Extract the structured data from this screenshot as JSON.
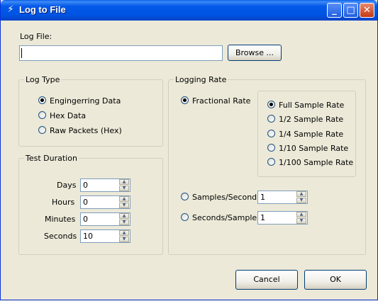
{
  "window": {
    "title": "Log to File",
    "min": "_",
    "max": "□",
    "close": "✕"
  },
  "log_file": {
    "label": "Log File:",
    "value": "",
    "browse_label": "Browse ..."
  },
  "log_type": {
    "title": "Log Type",
    "options": [
      {
        "label": "Engingerring Data",
        "checked": true
      },
      {
        "label": "Hex Data",
        "checked": false
      },
      {
        "label": "Raw Packets (Hex)",
        "checked": false
      }
    ]
  },
  "test_duration": {
    "title": "Test Duration",
    "fields": [
      {
        "label": "Days",
        "value": "0"
      },
      {
        "label": "Hours",
        "value": "0"
      },
      {
        "label": "Minutes",
        "value": "0"
      },
      {
        "label": "Seconds",
        "value": "10"
      }
    ]
  },
  "logging_rate": {
    "title": "Logging Rate",
    "fractional_label": "Fractional Rate",
    "fractional_checked": true,
    "sub_options": [
      {
        "label": "Full Sample Rate",
        "checked": true
      },
      {
        "label": "1/2 Sample Rate",
        "checked": false
      },
      {
        "label": "1/4 Sample Rate",
        "checked": false
      },
      {
        "label": "1/10 Sample Rate",
        "checked": false
      },
      {
        "label": "1/100 Sample Rate",
        "checked": false
      }
    ],
    "samples_per_second": {
      "label": "Samples/Second",
      "value": "1"
    },
    "seconds_per_sample": {
      "label": "Seconds/Sample",
      "value": "1"
    }
  },
  "footer": {
    "cancel_label": "Cancel",
    "ok_label": "OK"
  }
}
